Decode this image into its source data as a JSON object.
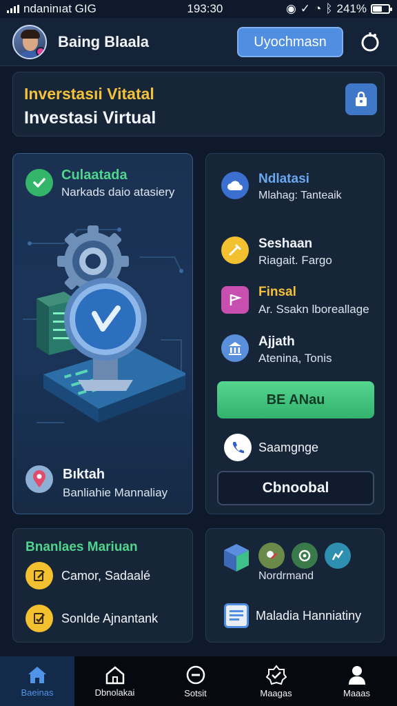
{
  "status_bar": {
    "carrier": "ndaninıat GIG",
    "time": "193:30",
    "battery": "241%"
  },
  "header": {
    "username": "Baing Blaala",
    "upgrade_label": "Uyochmasn"
  },
  "banner": {
    "title_accent": "Inverstasıi Vitatal",
    "title": "Investasi Virtual"
  },
  "left_card": {
    "top_title": "Culaatada",
    "top_sub": "Narkads daio atasiery",
    "bottom_title": "Bıktah",
    "bottom_sub": "Banliahie Mannaliay"
  },
  "right_card": {
    "items": [
      {
        "title": "Ndlatasi",
        "sub": "Mlahag: Tanteaik"
      },
      {
        "title": "Seshaan",
        "sub": "Riagait. Fargo"
      },
      {
        "title": "Finsal",
        "sub": "Ar. Ssakn lboreallage"
      },
      {
        "title": "Ajjath",
        "sub": "Atenina, Tonis"
      }
    ],
    "primary_button": "BE ANau",
    "link_label": "Saamgnge",
    "secondary_button": "Cbnoobal"
  },
  "bottom_left": {
    "title": "Bnanlaes Mariuan",
    "items": [
      "Camor, Sadaalé",
      "Sonlde Ajnantank"
    ]
  },
  "bottom_right": {
    "caption": "Nordrmand",
    "item": "Maladia Hanniatiny"
  },
  "bottom_nav": [
    "Baeinas",
    "Dbnolakai",
    "Sotsit",
    "Maagas",
    "Maaas"
  ],
  "colors": {
    "accent_yellow": "#f3c13a",
    "accent_green": "#4fd58c",
    "primary_blue": "#4f8ee0",
    "background": "#0e1a2b"
  }
}
